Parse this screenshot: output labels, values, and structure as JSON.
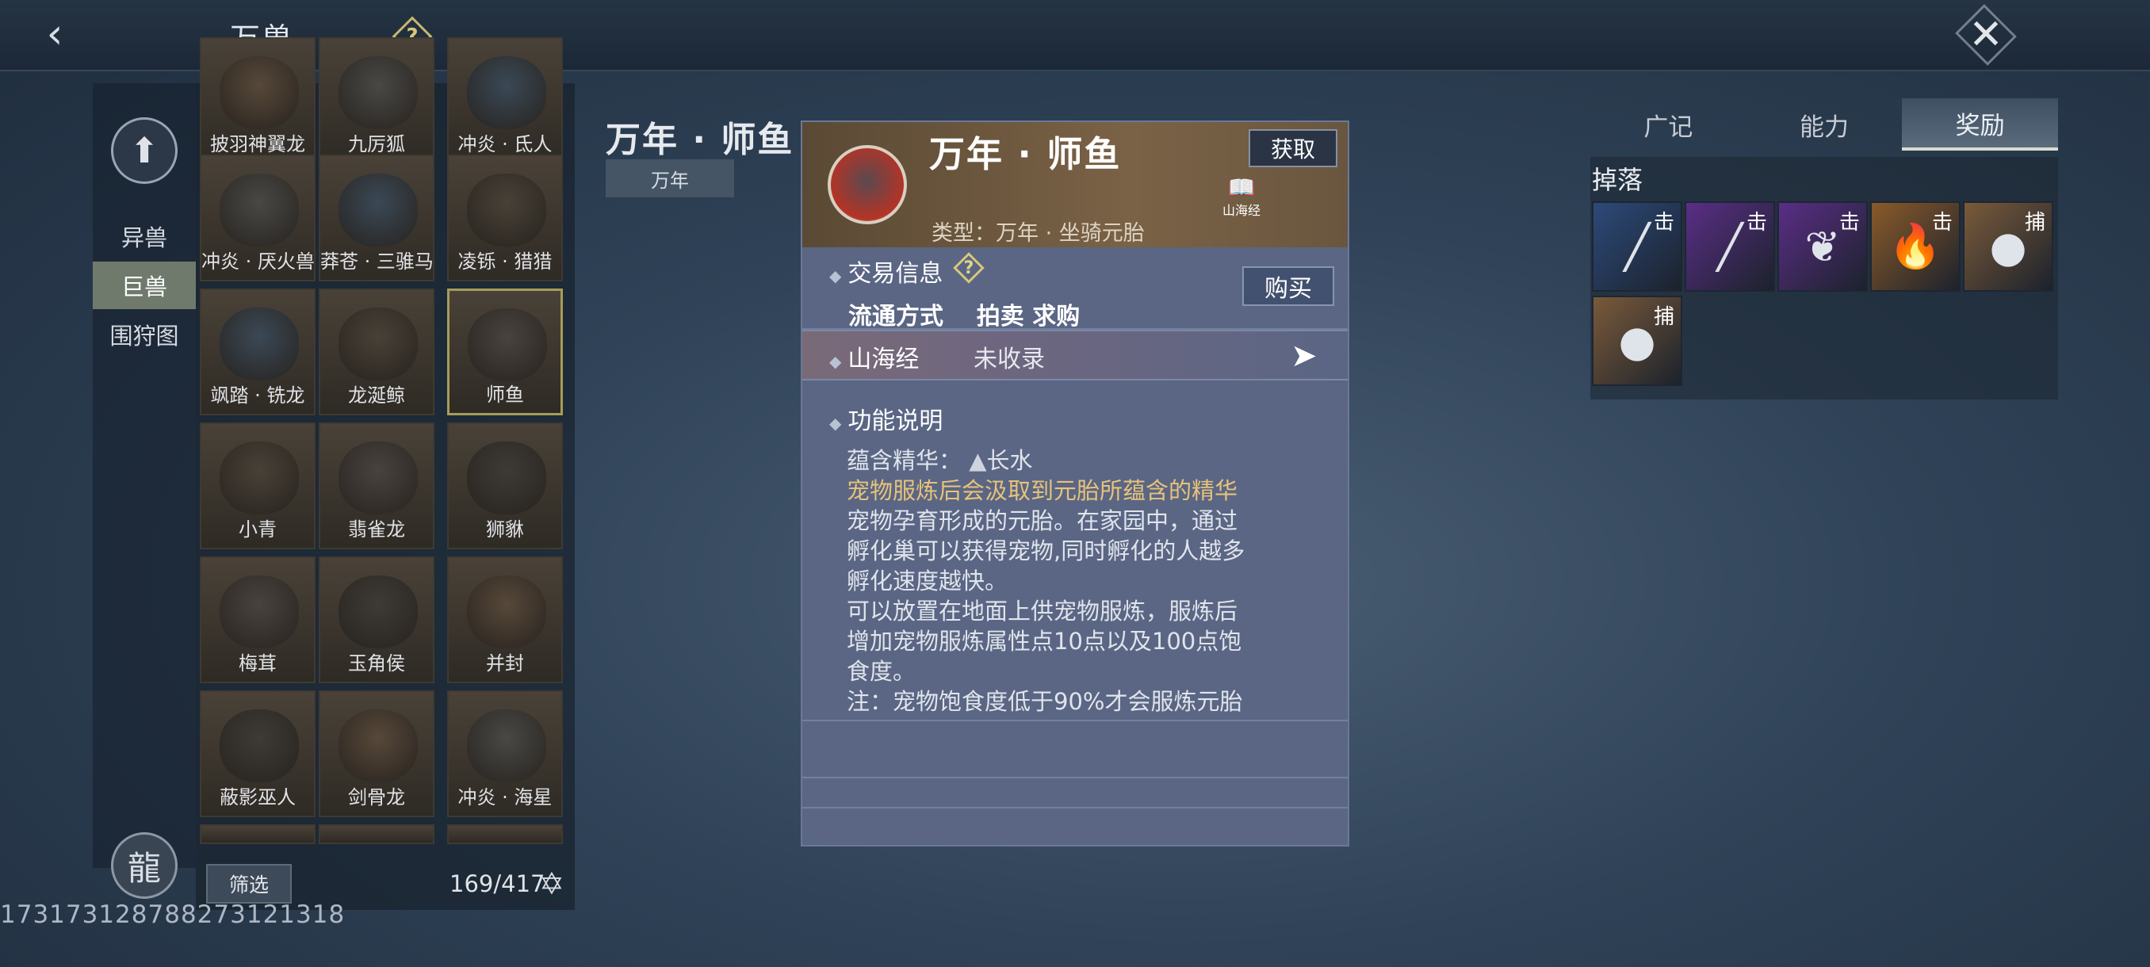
{
  "header": {
    "title": "万兽",
    "help": "?",
    "back": "‹",
    "close": "✕"
  },
  "sidebar": {
    "up": "⬆",
    "categories": [
      "异兽",
      "巨兽",
      "围狩图"
    ],
    "active": 1,
    "emblem": "龍"
  },
  "grid": {
    "rows": [
      [
        "披羽神翼龙",
        "九厉狐",
        "冲炎 · 氐人"
      ],
      [
        "冲炎 · 厌火兽",
        "莽苍 · 三骓马",
        "凌铄 · 猎猎"
      ],
      [
        "飒踏 · 铣龙",
        "龙涎鲸",
        "师鱼"
      ],
      [
        "小青",
        "翡雀龙",
        "狮貅"
      ],
      [
        "梅茸",
        "玉角侯",
        "并封"
      ],
      [
        "蔽影巫人",
        "剑骨龙",
        "冲炎 · 海星"
      ]
    ],
    "selected": "师鱼",
    "filter": "筛选",
    "count": "169/417"
  },
  "uid": "1731731287882731213​18",
  "main": {
    "title": "万年 · 师鱼",
    "badge": "万年"
  },
  "panel": {
    "name": "万年 · 师鱼",
    "type": "类型：万年 · 坐骑元胎",
    "get": "获取",
    "book_label": "山海经",
    "trade_title": "交易信息",
    "trade_line": "流通方式    拍卖 求购",
    "buy": "购买",
    "shanhai_label": "山海经",
    "shanhai_status": "未收录",
    "func_title": "功能说明",
    "essence": "蕴含精华：",
    "essence_val": "长水",
    "gold_line": "宠物服炼后会汲取到元胎所蕴含的精华",
    "desc_lines": [
      "宠物孕育形成的元胎。在家园中，通过",
      "孵化巢可以获得宠物,同时孵化的人越多",
      "孵化速度越快。",
      "可以放置在地面上供宠物服炼，服炼后",
      "增加宠物服炼属性点10点以及100点饱",
      "食度。",
      "注：宠物饱食度低于90%才会服炼元胎"
    ]
  },
  "right": {
    "tabs": [
      "广记",
      "能力",
      "奖励"
    ],
    "active_tab": 2,
    "drops_title": "掉落",
    "drops": [
      {
        "tag": "击",
        "icon": "spear-icon",
        "glyph": "╱",
        "bg": "#2c4a7a"
      },
      {
        "tag": "击",
        "icon": "staff-icon",
        "glyph": "╱",
        "bg": "#5a2e86"
      },
      {
        "tag": "击",
        "icon": "hide-icon",
        "glyph": "❦",
        "bg": "#5a2e86"
      },
      {
        "tag": "击",
        "icon": "flame-icon",
        "glyph": "🔥",
        "bg": "#8a5a2a"
      },
      {
        "tag": "捕",
        "icon": "shiyu-icon",
        "glyph": "●",
        "bg": "#7a5a3a"
      },
      {
        "tag": "捕",
        "icon": "beast-icon",
        "glyph": "●",
        "bg": "#7a5a3a"
      }
    ]
  }
}
